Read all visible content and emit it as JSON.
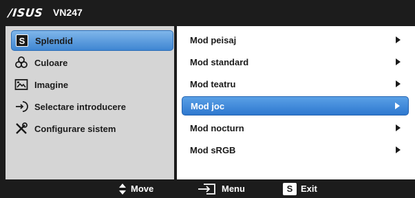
{
  "header": {
    "brand": "/ISUS",
    "model": "VN247"
  },
  "left_menu": {
    "items": [
      {
        "label": "Splendid",
        "icon": "splendid-s-icon",
        "selected": true
      },
      {
        "label": "Culoare",
        "icon": "color-circles-icon",
        "selected": false
      },
      {
        "label": "Imagine",
        "icon": "image-icon",
        "selected": false
      },
      {
        "label": "Selectare introducere",
        "icon": "input-select-icon",
        "selected": false
      },
      {
        "label": "Configurare sistem",
        "icon": "tools-icon",
        "selected": false
      }
    ]
  },
  "right_menu": {
    "items": [
      {
        "label": "Mod peisaj",
        "selected": false
      },
      {
        "label": "Mod standard",
        "selected": false
      },
      {
        "label": "Mod teatru",
        "selected": false
      },
      {
        "label": "Mod joc",
        "selected": true
      },
      {
        "label": "Mod nocturn",
        "selected": false
      },
      {
        "label": "Mod sRGB",
        "selected": false
      }
    ]
  },
  "footer": {
    "move_label": "Move",
    "menu_label": "Menu",
    "exit_label": "Exit",
    "exit_key": "S"
  },
  "colors": {
    "background": "#1c1c1c",
    "left_panel": "#d5d5d5",
    "selection": "#3f86d2"
  }
}
